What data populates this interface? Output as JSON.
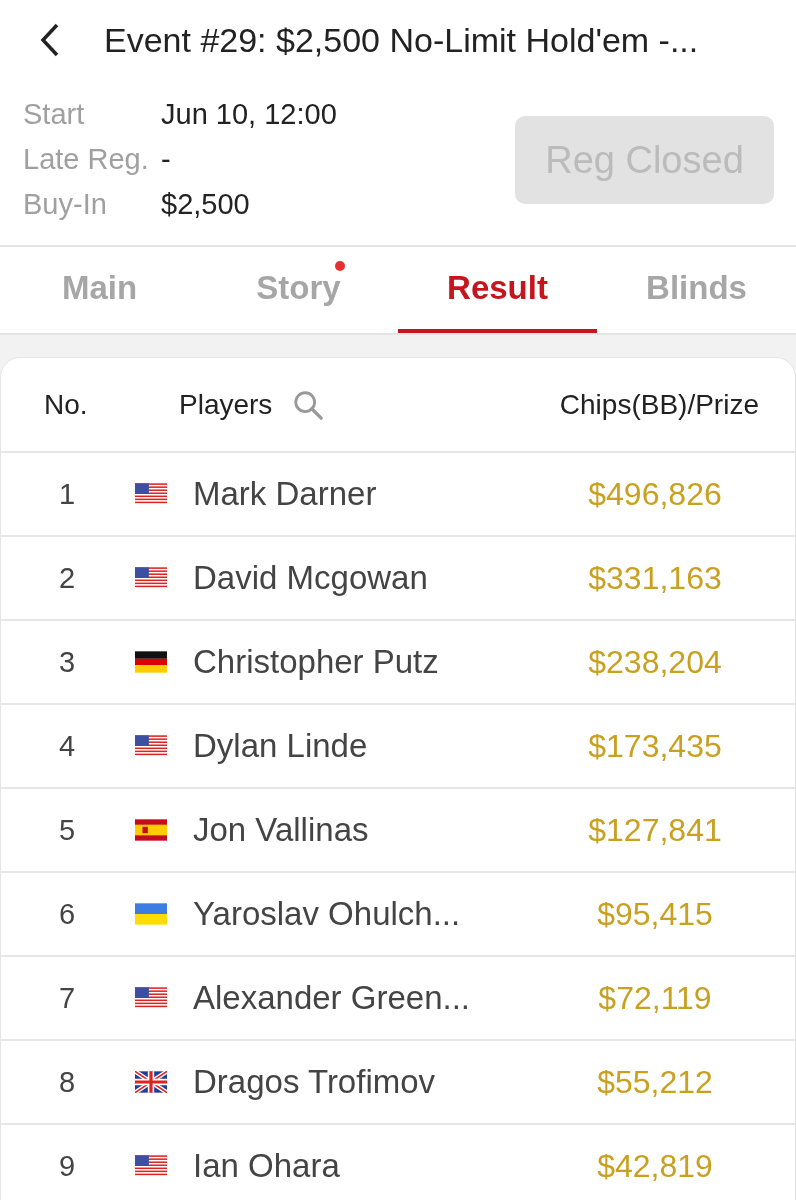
{
  "header": {
    "title": "Event #29: $2,500 No-Limit Hold'em -..."
  },
  "info": [
    {
      "label": "Start",
      "value": "Jun 10, 12:00"
    },
    {
      "label": "Late Reg.",
      "value": "-"
    },
    {
      "label": "Buy-In",
      "value": "$2,500"
    }
  ],
  "register_button": {
    "label": "Reg Closed",
    "disabled": true
  },
  "tabs": [
    {
      "label": "Main",
      "selected": false,
      "notification": false
    },
    {
      "label": "Story",
      "selected": false,
      "notification": true
    },
    {
      "label": "Result",
      "selected": true,
      "notification": false
    },
    {
      "label": "Blinds",
      "selected": false,
      "notification": false
    }
  ],
  "table": {
    "columns": [
      "No.",
      "Players",
      "Chips(BB)/Prize"
    ],
    "rows": [
      {
        "no": "1",
        "kind": "us",
        "player": "Mark Darner",
        "prize": "$496,826"
      },
      {
        "no": "2",
        "kind": "us",
        "player": "David Mcgowan",
        "prize": "$331,163"
      },
      {
        "no": "3",
        "kind": "de",
        "player": "Christopher Putz",
        "prize": "$238,204"
      },
      {
        "no": "4",
        "kind": "us",
        "player": "Dylan Linde",
        "prize": "$173,435"
      },
      {
        "no": "5",
        "kind": "es",
        "player": "Jon Vallinas",
        "prize": "$127,841"
      },
      {
        "no": "6",
        "kind": "ua",
        "player": "Yaroslav Ohulch...",
        "prize": "$95,415"
      },
      {
        "no": "7",
        "kind": "us",
        "player": "Alexander Green...",
        "prize": "$72,119"
      },
      {
        "no": "8",
        "kind": "gb",
        "player": "Dragos Trofimov",
        "prize": "$55,212"
      },
      {
        "no": "9",
        "kind": "us",
        "player": "Ian Ohara",
        "prize": "$42,819"
      }
    ]
  }
}
